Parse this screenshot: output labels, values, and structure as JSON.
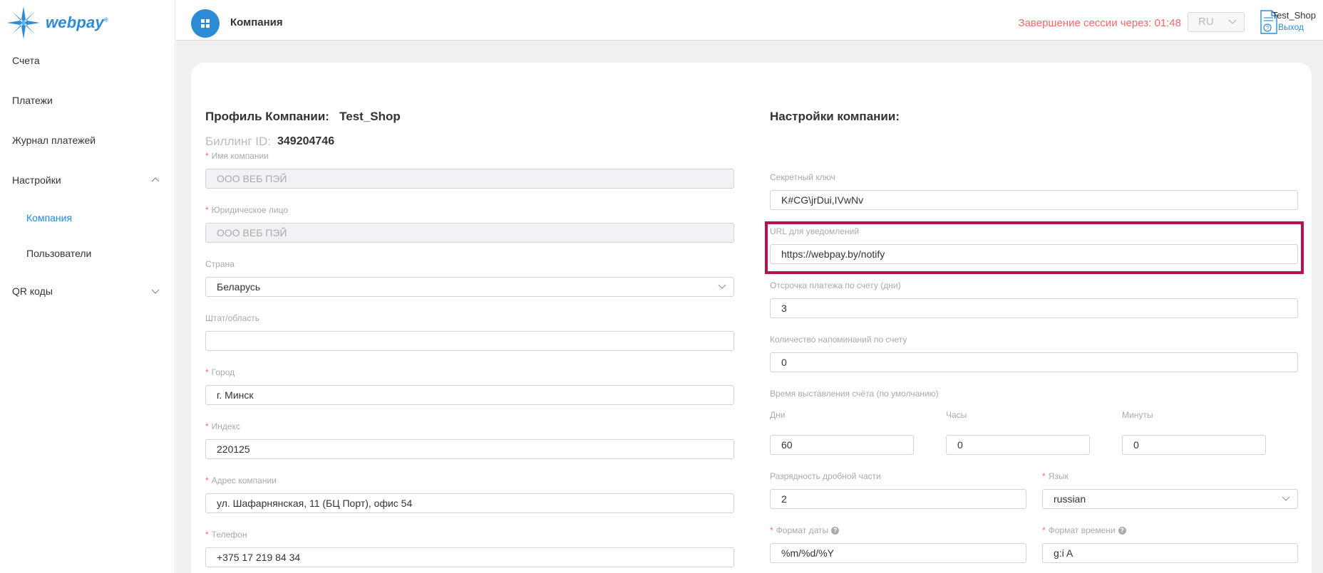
{
  "brand": {
    "logo_text": "webpay",
    "logo_mark": "®"
  },
  "sidebar": {
    "items": [
      {
        "label": "Счета"
      },
      {
        "label": "Платежи"
      },
      {
        "label": "Журнал платежей"
      },
      {
        "label": "Настройки",
        "expanded": true
      },
      {
        "label": "Компания",
        "active": true
      },
      {
        "label": "Пользователи"
      },
      {
        "label": "QR коды",
        "expanded": false
      }
    ]
  },
  "header": {
    "title": "Компания",
    "session": "Завершение сессии через: 01:48",
    "language": "RU",
    "user": "Test_Shop",
    "logout": "Выход"
  },
  "profile": {
    "title": "Профиль Компании:",
    "shop_name": "Test_Shop",
    "billing_label": "Биллинг ID:",
    "billing_id": "349204746",
    "fields": {
      "company_name": {
        "label": "Имя компании",
        "value": "ООО ВЕБ ПЭЙ"
      },
      "legal_entity": {
        "label": "Юридическое лицо",
        "value": "ООО ВЕБ ПЭЙ"
      },
      "country": {
        "label": "Страна",
        "value": "Беларусь"
      },
      "state": {
        "label": "Штат/область",
        "value": ""
      },
      "city": {
        "label": "Город",
        "value": "г. Минск"
      },
      "zip": {
        "label": "Индекс",
        "value": "220125"
      },
      "address": {
        "label": "Адрес компании",
        "value": "ул. Шафарнянская, 11 (БЦ Порт), офис 54"
      },
      "phone": {
        "label": "Телефон",
        "value": "+375 17 219 84 34"
      }
    }
  },
  "settings": {
    "title": "Настройки компании:",
    "fields": {
      "secret_key": {
        "label": "Секретный ключ",
        "value": "K#CG\\jrDui,IVwNv"
      },
      "notify_url": {
        "label": "URL для уведомлений",
        "value": "https://webpay.by/notify"
      },
      "payment_delay": {
        "label": "Отсрочка платежа по счету (дни)",
        "value": "3"
      },
      "reminders": {
        "label": "Количество напоминаний по счету",
        "value": "0"
      },
      "invoice_time": {
        "label": "Время выставления счёта (по умолчанию)",
        "days": {
          "label": "Дни",
          "value": "60"
        },
        "hours": {
          "label": "Часы",
          "value": "0"
        },
        "minutes": {
          "label": "Минуты",
          "value": "0"
        }
      },
      "decimals": {
        "label": "Разрядность дробной части",
        "value": "2"
      },
      "language": {
        "label": "Язык",
        "value": "russian"
      },
      "date_format": {
        "label": "Формат даты",
        "value": "%m/%d/%Y"
      },
      "time_format": {
        "label": "Формат времени",
        "value": "g:i A"
      }
    }
  },
  "colors": {
    "accent": "#2d8bd6",
    "session": "#ef6a6a",
    "highlight": "#b5124f",
    "required": "#f56c6c"
  }
}
